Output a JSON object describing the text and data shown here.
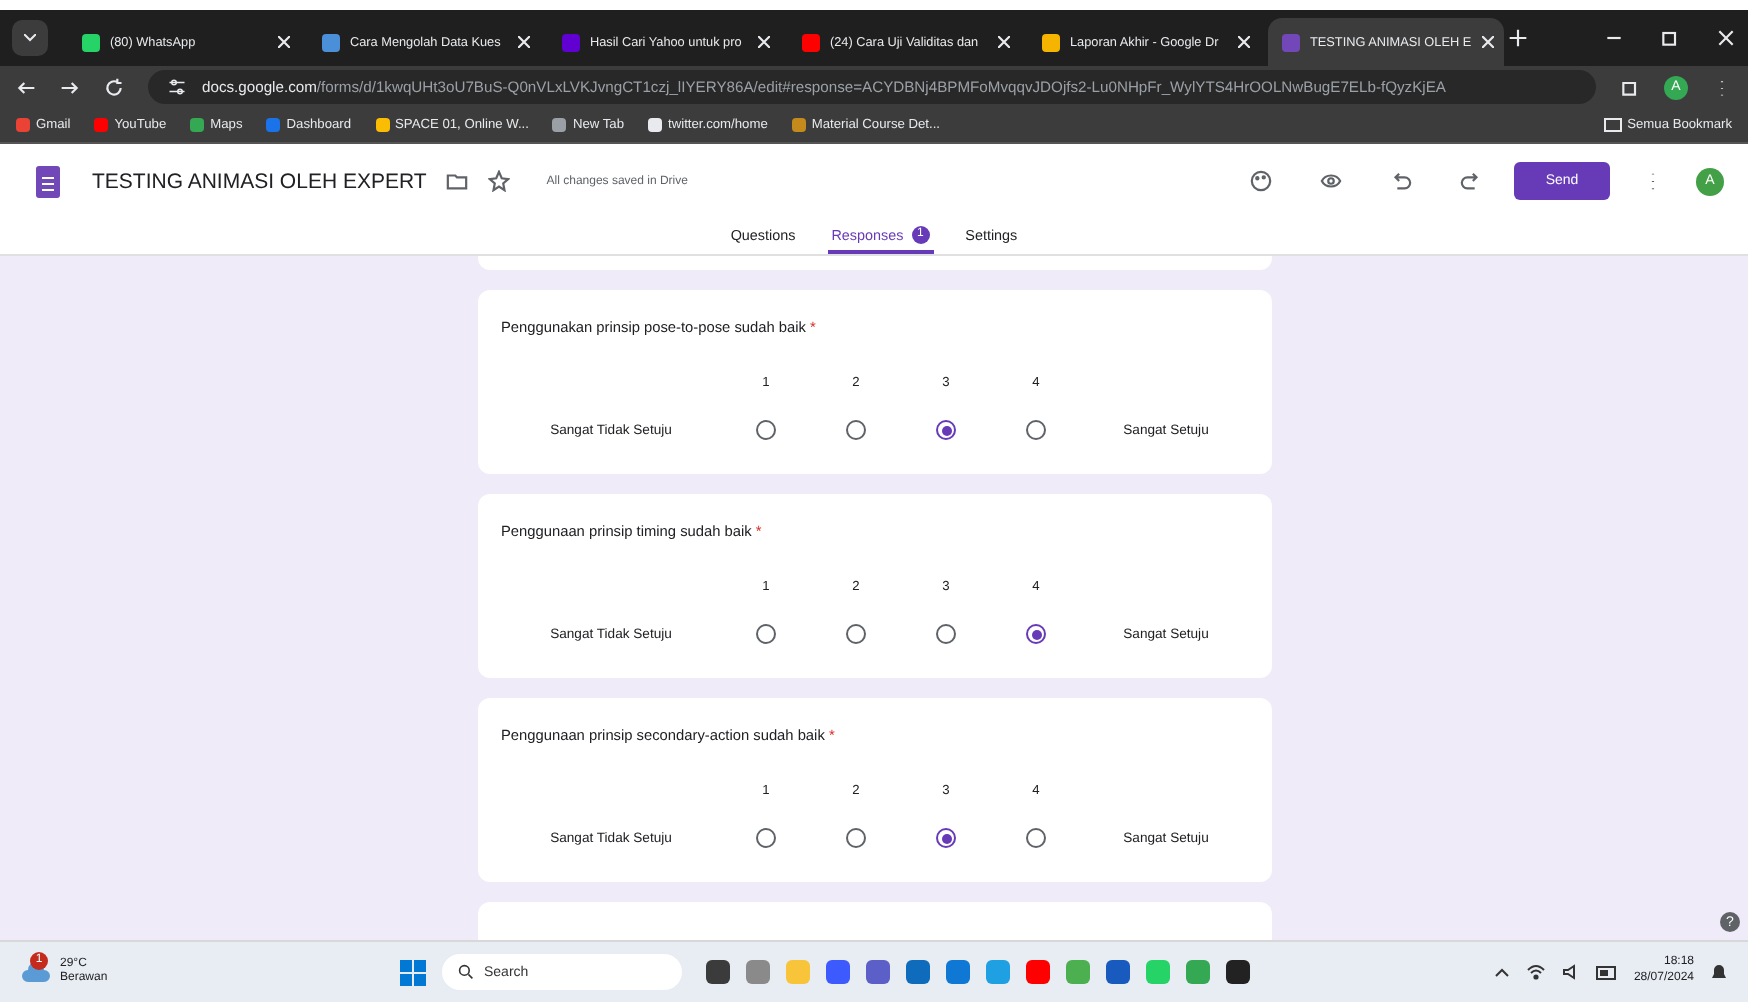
{
  "browser_tabs": [
    {
      "title": "(80) WhatsApp",
      "color": "#25d366",
      "selected": false
    },
    {
      "title": "Cara Mengolah Data Kues",
      "color": "#4a8fd8",
      "selected": false
    },
    {
      "title": "Hasil Cari Yahoo untuk pro",
      "color": "#6001d2",
      "selected": false
    },
    {
      "title": "(24) Cara Uji Validitas dan",
      "color": "#ff0000",
      "selected": false
    },
    {
      "title": "Laporan Akhir - Google Dr",
      "color": "#f4b400",
      "selected": false
    },
    {
      "title": "TESTING ANIMASI OLEH E",
      "color": "#7248b9",
      "selected": true
    }
  ],
  "address": {
    "host": "docs.google.com",
    "path": "/forms/d/1kwqUHt3oU7BuS-Q0nVLxLVKJvngCT1czj_lIYERY86A/edit#response=ACYDBNj4BPMFoMvqqvJDOjfs2-Lu0NHpFr_WylYTS4HrOOLNwBugE7ELb-fQyzKjEA"
  },
  "profile_initial": "A",
  "bookmarks": [
    {
      "label": "Gmail",
      "color": "#ea4335"
    },
    {
      "label": "YouTube",
      "color": "#ff0000"
    },
    {
      "label": "Maps",
      "color": "#34a853"
    },
    {
      "label": "Dashboard",
      "color": "#1a73e8"
    },
    {
      "label": "SPACE 01, Online W...",
      "color": "#fbbc04"
    },
    {
      "label": "New Tab",
      "color": "#9aa0a6"
    },
    {
      "label": "twitter.com/home",
      "color": "#e8eaed"
    },
    {
      "label": "Material Course Det...",
      "color": "#c58a1c"
    }
  ],
  "all_bookmarks": "Semua Bookmark",
  "form": {
    "title": "TESTING ANIMASI OLEH EXPERT",
    "save_status": "All changes saved in Drive",
    "send": "Send",
    "user_initial": "A"
  },
  "form_tabs": [
    {
      "label": "Questions",
      "selected": false
    },
    {
      "label": "Responses",
      "selected": true,
      "badge": "1"
    },
    {
      "label": "Settings",
      "selected": false
    }
  ],
  "questions": [
    {
      "text": "Penggunakan prinsip pose-to-pose sudah baik",
      "required_mark": "*",
      "low": "Sangat Tidak Setuju",
      "high": "Sangat Setuju",
      "options": [
        {
          "label": "1",
          "selected": false
        },
        {
          "label": "2",
          "selected": false
        },
        {
          "label": "3",
          "selected": true
        },
        {
          "label": "4",
          "selected": false
        }
      ]
    },
    {
      "text": "Penggunaan prinsip timing sudah baik",
      "required_mark": "*",
      "low": "Sangat Tidak Setuju",
      "high": "Sangat Setuju",
      "options": [
        {
          "label": "1",
          "selected": false
        },
        {
          "label": "2",
          "selected": false
        },
        {
          "label": "3",
          "selected": false
        },
        {
          "label": "4",
          "selected": true
        }
      ]
    },
    {
      "text": "Penggunaan prinsip secondary-action sudah baik",
      "required_mark": "*",
      "low": "Sangat Tidak Setuju",
      "high": "Sangat Setuju",
      "options": [
        {
          "label": "1",
          "selected": false
        },
        {
          "label": "2",
          "selected": false
        },
        {
          "label": "3",
          "selected": true
        },
        {
          "label": "4",
          "selected": false
        }
      ]
    }
  ],
  "help_button": "?",
  "taskbar": {
    "temperature": "29°C",
    "weather": "Berawan",
    "weather_badge": "1",
    "search": "Search",
    "time": "18:18",
    "date": "28/07/2024",
    "apps": [
      {
        "color": "#3b3b3b"
      },
      {
        "color": "#8a8a8a"
      },
      {
        "color": "#f8c53a"
      },
      {
        "color": "#3d5afe"
      },
      {
        "color": "#5b5fc7"
      },
      {
        "color": "#0f6cbd"
      },
      {
        "color": "#0f78d4"
      },
      {
        "color": "#1fa0e3"
      },
      {
        "color": "#ff0000"
      },
      {
        "color": "#4caf50"
      },
      {
        "color": "#185abd"
      },
      {
        "color": "#25d366"
      },
      {
        "color": "#34a853"
      },
      {
        "color": "#222222"
      }
    ]
  }
}
